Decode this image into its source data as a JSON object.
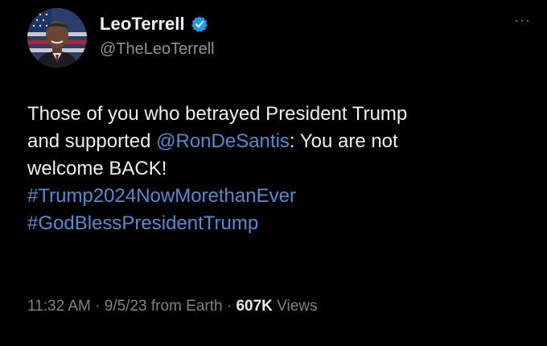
{
  "author": {
    "display_name": "LeoTerrell",
    "handle": "@TheLeoTerrell",
    "verified": true
  },
  "more_label": "···",
  "tweet": {
    "line1": "Those of you who betrayed President Trump",
    "line2_prefix": "and supported ",
    "mention": "@RonDeSantis",
    "line2_suffix": ": You are not",
    "line3": "welcome BACK!",
    "hashtag1": "#Trump2024NowMorethanEver",
    "hashtag2": "#GodBlessPresidentTrump"
  },
  "meta": {
    "time": "11:32 AM",
    "sep1": " · ",
    "date": "9/5/23",
    "source": " from Earth",
    "sep2": " · ",
    "views_count": "607K",
    "views_label": " Views"
  },
  "colors": {
    "background": "#000000",
    "link": "#4a8fd6",
    "verified_badge": "#1d9bf0",
    "secondary_text": "#7b838a"
  }
}
